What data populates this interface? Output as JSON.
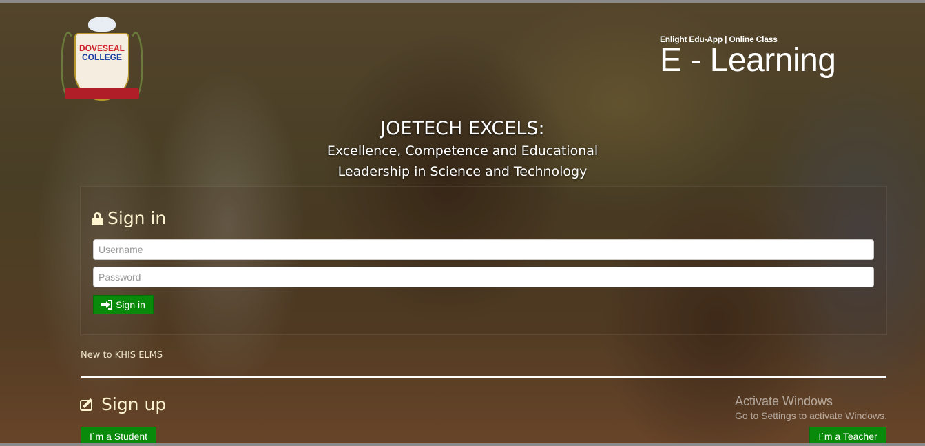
{
  "logo": {
    "line1": "DOVESEAL",
    "line2": "COLLEGE"
  },
  "brand": {
    "subtitle": "Enlight Edu-App | Online Class",
    "title": "E - Learning"
  },
  "motto": {
    "title": "JOETECH EXCELS:",
    "line1": "Excellence, Competence and Educational",
    "line2": "Leadership in Science and Technology"
  },
  "signin": {
    "heading": "Sign in",
    "heading_icon": "lock-icon",
    "username_placeholder": "Username",
    "password_placeholder": "Password",
    "username_value": "",
    "password_value": "",
    "button_label": "Sign in",
    "button_icon": "sign-in-icon"
  },
  "new_to": "New to KHIS ELMS",
  "signup": {
    "heading": "Sign up",
    "heading_icon": "edit-icon",
    "student_label": "I`m a Student",
    "teacher_label": "I`m a Teacher"
  },
  "watermark": {
    "title": "Activate Windows",
    "subtitle": "Go to Settings to activate Windows."
  },
  "colors": {
    "button_green": "#0a8a0a",
    "heading_cream": "#fff3d0",
    "text_white": "#ffffff"
  }
}
